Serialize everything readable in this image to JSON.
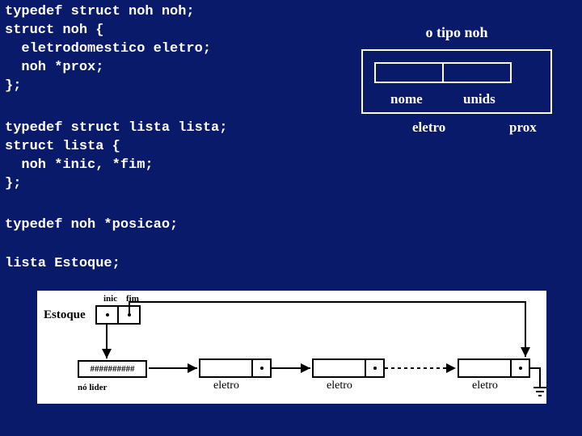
{
  "code": {
    "block1": "typedef struct noh noh;\nstruct noh {\n  eletrodomestico eletro;\n  noh *prox;\n};",
    "block2": "typedef struct lista lista;\nstruct lista {\n  noh *inic, *fim;\n};",
    "block3": "typedef noh *posicao;",
    "block4": "lista Estoque;"
  },
  "type_diagram": {
    "title": "o tipo noh",
    "field_nome": "nome",
    "field_unids": "unids",
    "label_eletro": "eletro",
    "label_prox": "prox"
  },
  "bottom": {
    "estoque_label": "Estoque",
    "inic": "inic",
    "fim": "fim",
    "hash": "##########",
    "lider": "nó lider",
    "node_label": "eletro"
  }
}
